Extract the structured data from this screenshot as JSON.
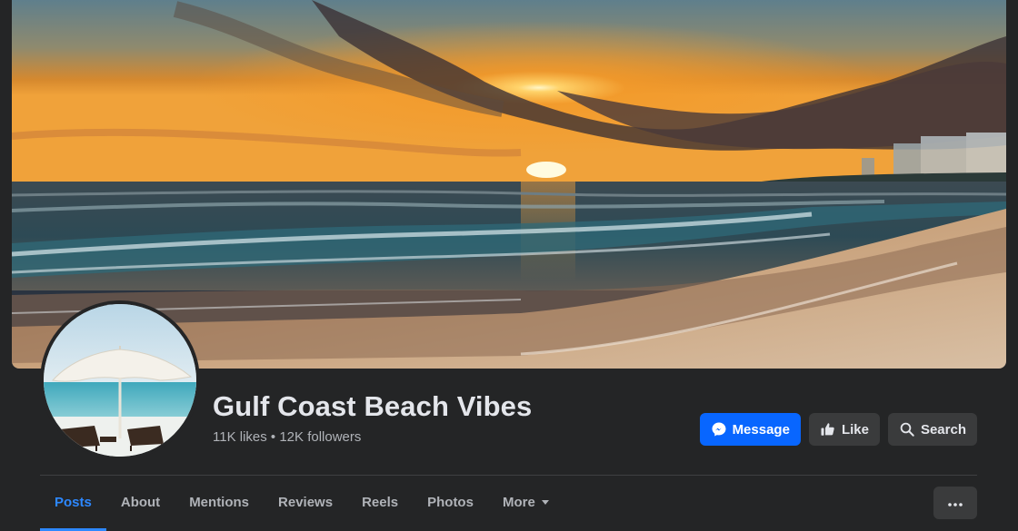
{
  "page": {
    "name": "Gulf Coast Beach Vibes",
    "stats": "11K likes • 12K followers"
  },
  "actions": {
    "message_label": "Message",
    "like_label": "Like",
    "search_label": "Search"
  },
  "tabs": [
    {
      "label": "Posts",
      "active": true
    },
    {
      "label": "About"
    },
    {
      "label": "Mentions"
    },
    {
      "label": "Reviews"
    },
    {
      "label": "Reels"
    },
    {
      "label": "Photos"
    },
    {
      "label": "More"
    }
  ],
  "colors": {
    "background": "#242526",
    "accent": "#0866ff",
    "active_tab": "#2d88ff",
    "secondary_button": "#3a3b3c",
    "text_primary": "#e4e6eb",
    "text_secondary": "#b0b3b8"
  },
  "icons": {
    "message": "messenger-icon",
    "like": "thumbs-up-icon",
    "search": "search-icon",
    "more": "ellipsis-icon",
    "tab_more": "caret-down-icon"
  }
}
